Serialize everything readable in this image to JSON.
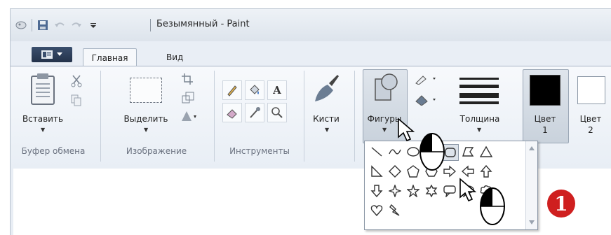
{
  "titlebar": {
    "title": "Безымянный - Paint"
  },
  "tabs": {
    "home": "Главная",
    "view": "Вид"
  },
  "clipboard": {
    "paste_label": "Вставить",
    "group_label": "Буфер обмена"
  },
  "image": {
    "select_label": "Выделить",
    "group_label": "Изображение"
  },
  "tools": {
    "group_label": "Инструменты",
    "text_tool": "A"
  },
  "brushes": {
    "label": "Кисти"
  },
  "shapes": {
    "label": "Фигуры"
  },
  "thickness": {
    "label": "Толщина"
  },
  "colors": {
    "color1_label": "Цвет",
    "color1_num": "1",
    "color2_label": "Цвет",
    "color2_num": "2",
    "color1": "#000000",
    "color2": "#ffffff"
  },
  "callout": {
    "number": "1"
  }
}
